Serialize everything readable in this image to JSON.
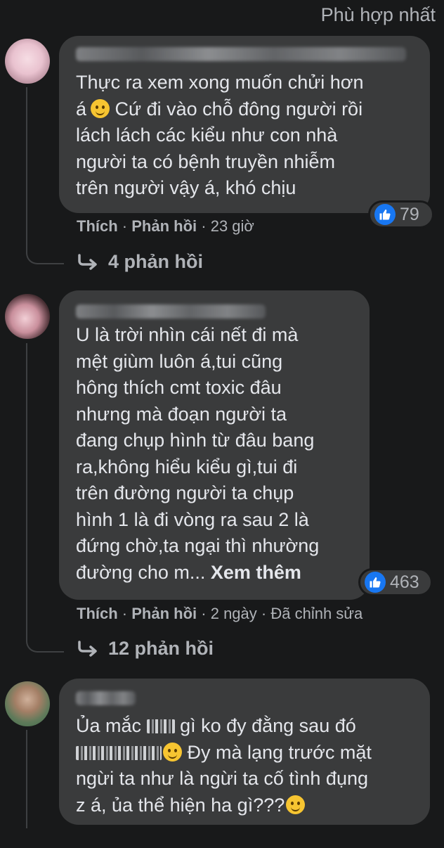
{
  "sort_label": "Phù hợp nhất",
  "comments": [
    {
      "text": "Thực ra xem xong muốn chửi hơn\ná",
      "text_after_emoji": " Cứ đi vào chỗ đông người rồi\nlách lách các kiểu như con nhà\nngười ta có bệnh truyền nhiễm\ntrên người vậy á, khó chịu",
      "reaction_count": "79",
      "like_label": "Thích",
      "reply_label": "Phản hồi",
      "time": "23 giờ",
      "replies_label": "4 phản hồi"
    },
    {
      "text": "U là trời nhìn cái nết đi mà\nmệt giùm luôn á,tui cũng\nhông thích cmt toxic đâu\nnhưng mà đoạn người ta\nđang chụp hình từ đâu bang\nra,không hiểu kiểu gì,tui đi\ntrên đường người ta chụp\nhình 1 là đi vòng ra sau 2 là\nđứng chờ,ta ngại thì nhường\nđường cho m...",
      "see_more": "Xem thêm",
      "reaction_count": "463",
      "like_label": "Thích",
      "reply_label": "Phản hồi",
      "time": "2 ngày",
      "edited": "Đã chỉnh sửa",
      "replies_label": "12 phản hồi"
    },
    {
      "text_a": "Ủa mắc",
      "text_b": "gì ko đy đằng sau đó",
      "text_c": "Đy mà lạng trước mặt\nngừi ta như là ngừi ta cố tình đụng\nz á, ủa thể hiện ha gì???"
    }
  ],
  "colors": {
    "background": "#18191a",
    "bubble": "#3a3b3c",
    "text": "#e4e6eb",
    "secondary_text": "#b0b3b8",
    "like_blue": "#1877f2"
  },
  "icons": [
    "like-icon",
    "reply-arrow-icon",
    "smile-emoji-icon"
  ]
}
